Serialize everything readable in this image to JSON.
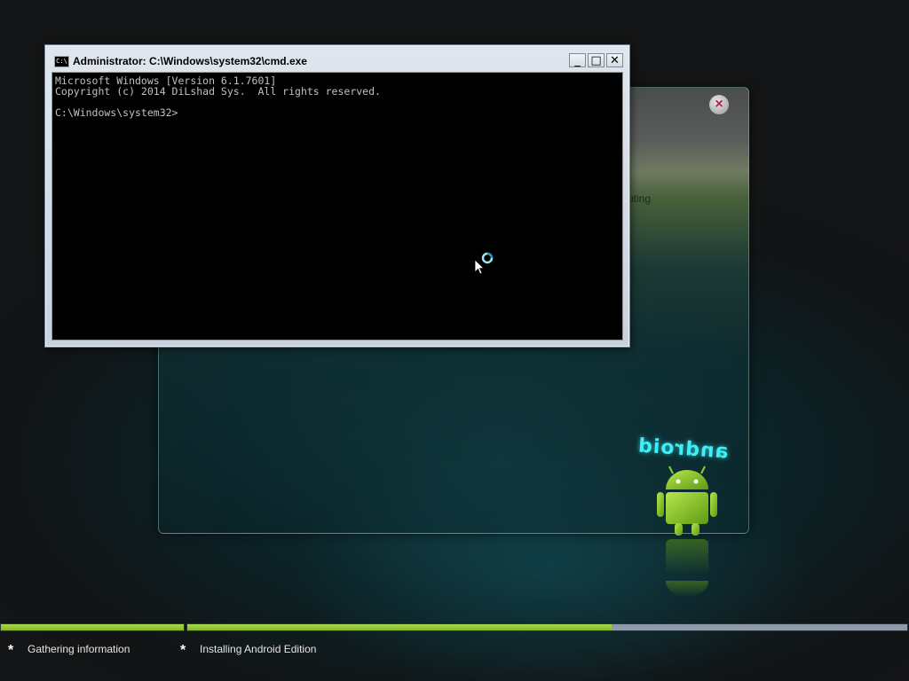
{
  "background_panel": {
    "partial_text": "uting",
    "close_label": "×"
  },
  "android_art": {
    "wordmark": "android",
    "icon": "android-robot-icon",
    "colors": {
      "robot": "#8fcf2a",
      "wordmark": "#3cf0f5"
    }
  },
  "cmd_window": {
    "icon_label": "C:\\",
    "title": "Administrator: C:\\Windows\\system32\\cmd.exe",
    "buttons": {
      "minimize": "_",
      "maximize": "□",
      "close": "✕"
    },
    "console_lines": [
      "Microsoft Windows [Version 6.1.7601]",
      "Copyright (c) 2014 DiLshad Sys.  All rights reserved.",
      "",
      "C:\\Windows\\system32>"
    ]
  },
  "progress": {
    "segments": [
      {
        "fraction": 1.0
      },
      {
        "fraction": 0.59
      }
    ],
    "colors": {
      "fill": "#8dc63f",
      "track": "#8d9aa8"
    }
  },
  "status_steps": [
    {
      "icon": "asterisk-icon",
      "label": "Gathering information"
    },
    {
      "icon": "asterisk-icon",
      "label": "Installing Android Edition"
    }
  ]
}
